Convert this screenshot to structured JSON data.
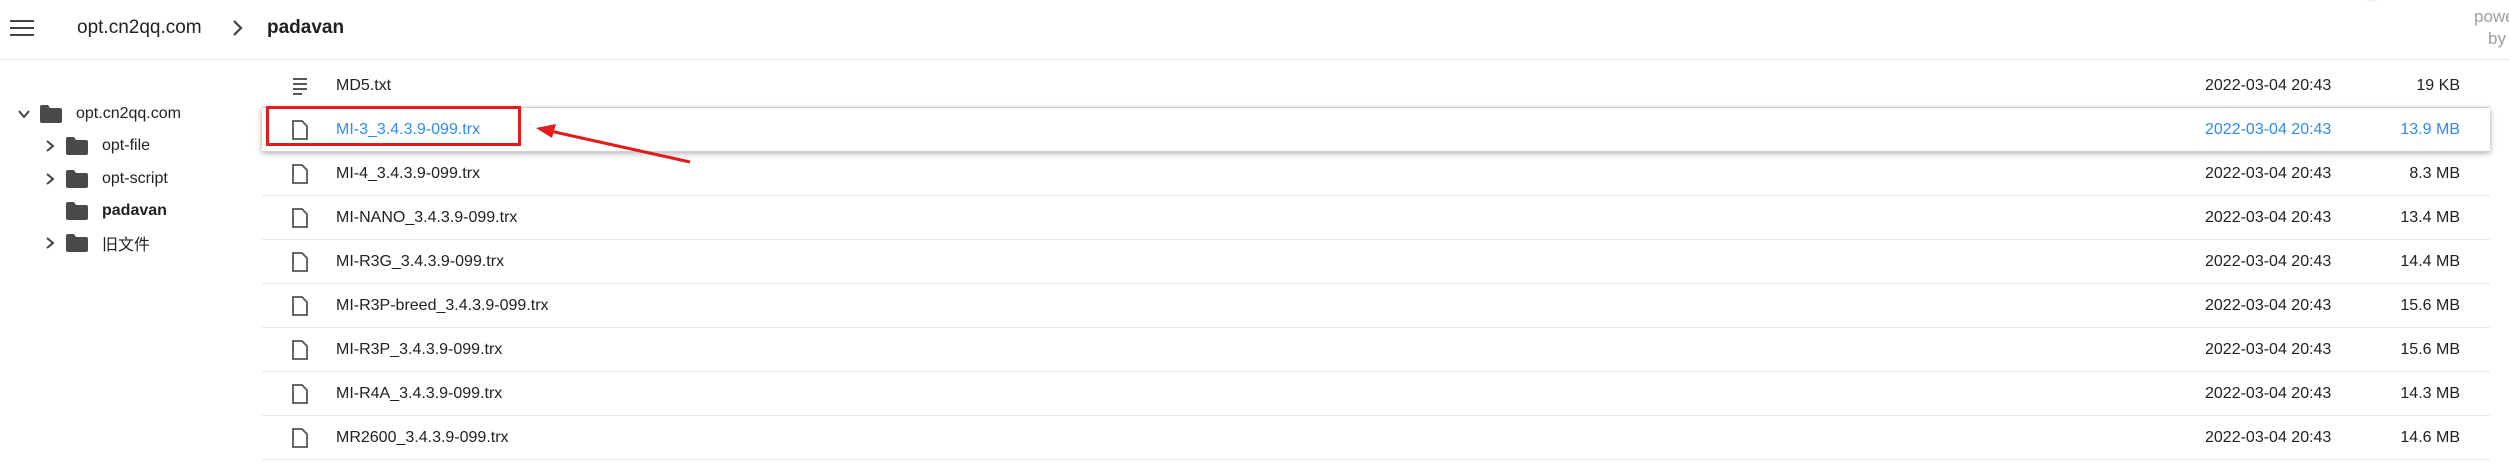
{
  "header": {
    "breadcrumb_root": "opt.cn2qq.com",
    "breadcrumb_current": "padavan",
    "powered_line1": "powe",
    "powered_line2": "by h"
  },
  "sidebar": {
    "root": {
      "label": "opt.cn2qq.com",
      "expanded": true
    },
    "items": [
      {
        "label": "opt-file",
        "has_children": true,
        "active": false
      },
      {
        "label": "opt-script",
        "has_children": true,
        "active": false
      },
      {
        "label": "padavan",
        "has_children": false,
        "active": true
      },
      {
        "label": "旧文件",
        "has_children": true,
        "active": false
      }
    ]
  },
  "files": [
    {
      "name": "MD5.txt",
      "date": "2022-03-04 20:43",
      "size": "19 KB",
      "icon": "text-file-icon"
    },
    {
      "name": "MI-3_3.4.3.9-099.trx",
      "date": "2022-03-04 20:43",
      "size": "13.9 MB",
      "icon": "file-icon",
      "selected": true
    },
    {
      "name": "MI-4_3.4.3.9-099.trx",
      "date": "2022-03-04 20:43",
      "size": "8.3 MB",
      "icon": "file-icon"
    },
    {
      "name": "MI-NANO_3.4.3.9-099.trx",
      "date": "2022-03-04 20:43",
      "size": "13.4 MB",
      "icon": "file-icon"
    },
    {
      "name": "MI-R3G_3.4.3.9-099.trx",
      "date": "2022-03-04 20:43",
      "size": "14.4 MB",
      "icon": "file-icon"
    },
    {
      "name": "MI-R3P-breed_3.4.3.9-099.trx",
      "date": "2022-03-04 20:43",
      "size": "15.6 MB",
      "icon": "file-icon"
    },
    {
      "name": "MI-R3P_3.4.3.9-099.trx",
      "date": "2022-03-04 20:43",
      "size": "15.6 MB",
      "icon": "file-icon"
    },
    {
      "name": "MI-R4A_3.4.3.9-099.trx",
      "date": "2022-03-04 20:43",
      "size": "14.3 MB",
      "icon": "file-icon"
    },
    {
      "name": "MR2600_3.4.3.9-099.trx",
      "date": "2022-03-04 20:43",
      "size": "14.6 MB",
      "icon": "file-icon"
    }
  ],
  "colors": {
    "selected_text": "#2d8cf0",
    "annotation_red": "#e31b1b",
    "folder": "#4a4a4a"
  }
}
